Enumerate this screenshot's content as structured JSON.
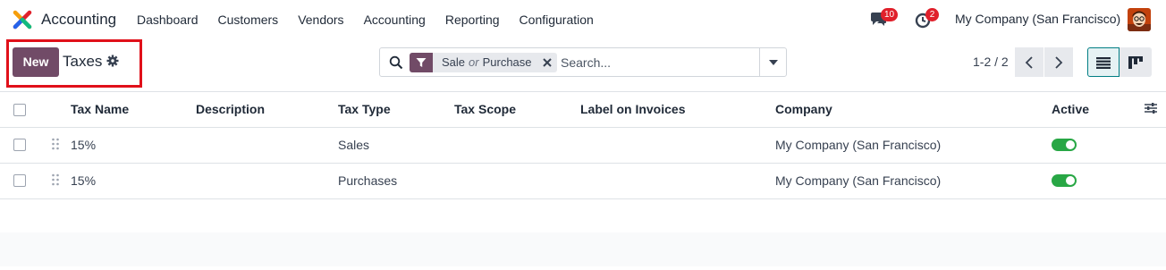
{
  "app": {
    "name": "Accounting",
    "logo_icon": "odoo-accounting-logo"
  },
  "menu": [
    "Dashboard",
    "Customers",
    "Vendors",
    "Accounting",
    "Reporting",
    "Configuration"
  ],
  "tray": {
    "messages_count": "10",
    "activities_count": "2",
    "company": "My Company (San Francisco)"
  },
  "control": {
    "new_label": "New",
    "title": "Taxes",
    "search": {
      "facet_values": [
        "Sale",
        "Purchase"
      ],
      "facet_separator": "or",
      "placeholder": "Search..."
    },
    "pager": "1-2 / 2"
  },
  "table": {
    "headers": [
      "Tax Name",
      "Description",
      "Tax Type",
      "Tax Scope",
      "Label on Invoices",
      "Company",
      "Active"
    ],
    "rows": [
      {
        "name": "15%",
        "description": "",
        "type": "Sales",
        "scope": "",
        "label": "",
        "company": "My Company (San Francisco)",
        "active": true
      },
      {
        "name": "15%",
        "description": "",
        "type": "Purchases",
        "scope": "",
        "label": "",
        "company": "My Company (San Francisco)",
        "active": true
      }
    ]
  },
  "colors": {
    "brand": "#714b67",
    "active_toggle": "#28a745",
    "badge": "#e0202b",
    "highlight": "#e0101a"
  }
}
